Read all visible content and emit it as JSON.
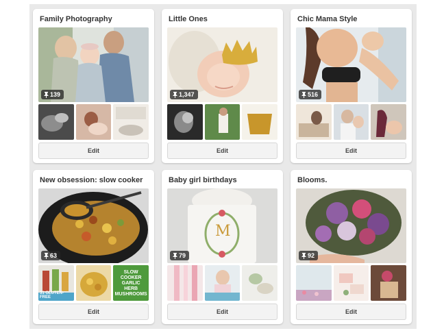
{
  "boards": [
    {
      "title": "Family Photography",
      "pin_count": "139",
      "edit_label": "Edit"
    },
    {
      "title": "Little Ones",
      "pin_count": "1,347",
      "edit_label": "Edit"
    },
    {
      "title": "Chic Mama Style",
      "pin_count": "516",
      "edit_label": "Edit"
    },
    {
      "title": "New obsession: slow cooker",
      "pin_count": "63",
      "edit_label": "Edit",
      "thumb_texts": {
        "gluten_free_line": "31 GLUTEN-FREE",
        "recipe_title": "SLOW COOKER GARLIC HERB MUSHROOMS"
      }
    },
    {
      "title": "Baby girl birthdays",
      "pin_count": "79",
      "edit_label": "Edit",
      "cake_monogram": "M"
    },
    {
      "title": "Blooms.",
      "pin_count": "92",
      "edit_label": "Edit"
    }
  ],
  "icons": {
    "pin": "pin-icon"
  },
  "colors": {
    "badge_bg": "#282828",
    "button_bg": "#f3f3f3",
    "page_bg": "#e9e9e9"
  }
}
